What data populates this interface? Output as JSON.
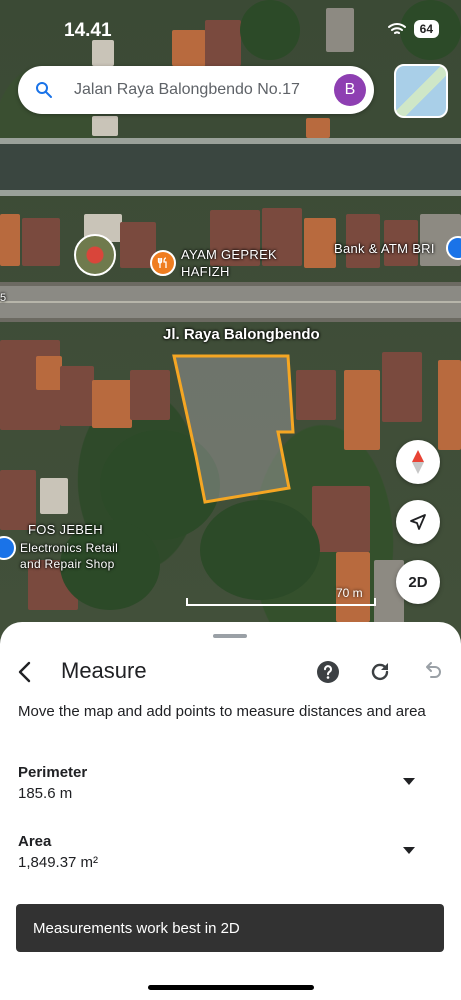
{
  "status_bar": {
    "time": "14.41",
    "battery": "64"
  },
  "search": {
    "text": "Jalan Raya Balongbendo No.17",
    "avatar_initial": "B"
  },
  "map": {
    "labels": {
      "restaurant": "AYAM GEPREK\nHAFIZH",
      "bank": "Bank & ATM BRI",
      "road": "Jl. Raya Balongbendo",
      "shop_name": "FOS JEBEH",
      "shop_category": "Electronics Retail\nand Repair Shop",
      "edge_number": "5"
    },
    "scale": "70 m",
    "mode_button": "2D",
    "polygon_outline_color": "#f5a623"
  },
  "sheet": {
    "title": "Measure",
    "description": "Move the map and add points to measure distances and area",
    "perimeter_label": "Perimeter",
    "perimeter_value": "185.6 m",
    "area_label": "Area",
    "area_value": "1,849.37 m²"
  },
  "toast": {
    "message": "Measurements work best in 2D"
  },
  "icons": {
    "search": "search-icon",
    "compass": "compass-icon",
    "location": "navigation-arrow-icon",
    "back": "back-arrow-icon",
    "help": "help-icon",
    "redo": "redo-icon",
    "undo": "undo-icon"
  }
}
